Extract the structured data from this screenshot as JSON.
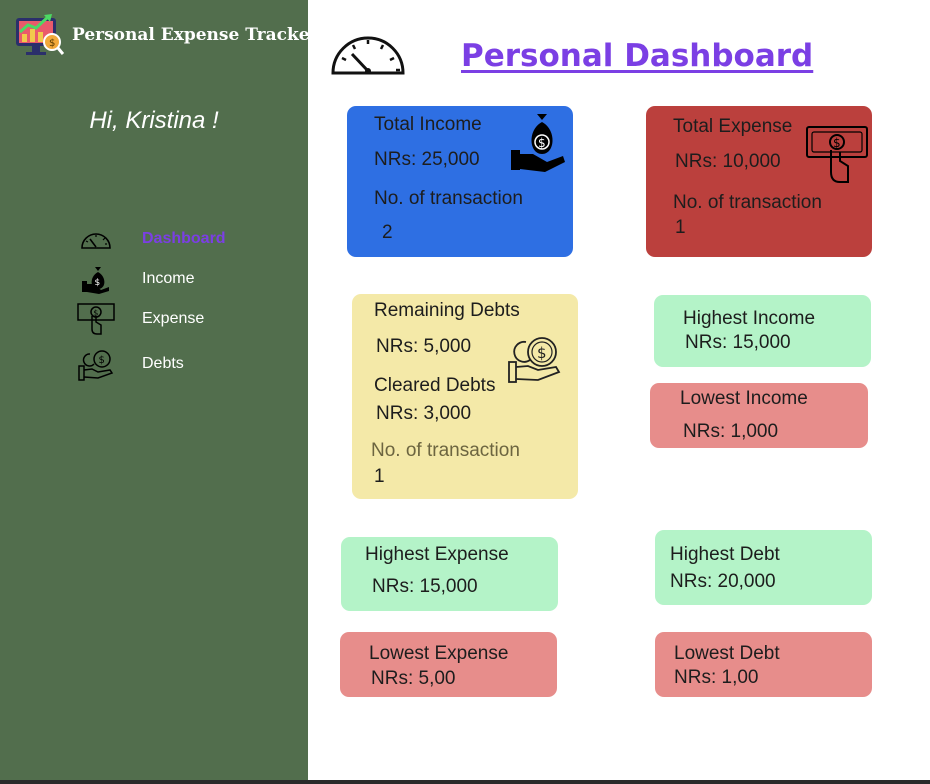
{
  "app": {
    "title": "Personal Expense Tracker"
  },
  "sidebar": {
    "greeting": "Hi, Kristina !",
    "items": [
      {
        "label": "Dashboard",
        "icon": "gauge-icon",
        "active": true
      },
      {
        "label": "Income",
        "icon": "money-bag-hand-icon",
        "active": false
      },
      {
        "label": "Expense",
        "icon": "bill-hand-icon",
        "active": false
      },
      {
        "label": "Debts",
        "icon": "coins-hand-icon",
        "active": false
      }
    ]
  },
  "header": {
    "title": "Personal Dashboard",
    "icon": "gauge-icon"
  },
  "cards": {
    "total_income": {
      "title": "Total Income",
      "amount": "NRs: 25,000",
      "tx_label": "No. of transaction",
      "tx_count": "2",
      "icon": "money-bag-hand-icon"
    },
    "total_expense": {
      "title": "Total Expense",
      "amount": "NRs: 10,000",
      "tx_label": "No. of transaction",
      "tx_count": "1",
      "icon": "bill-hand-icon"
    },
    "debts": {
      "remaining_label": "Remaining Debts",
      "remaining_amount": "NRs: 5,000",
      "cleared_label": "Cleared Debts",
      "cleared_amount": "NRs: 3,000",
      "tx_label": "No. of transaction",
      "tx_count": "1",
      "icon": "coins-hand-icon"
    },
    "highest_income": {
      "title": "Highest Income",
      "amount": "NRs: 15,000"
    },
    "lowest_income": {
      "title": "Lowest Income",
      "amount": "NRs: 1,000"
    },
    "highest_expense": {
      "title": "Highest Expense",
      "amount": "NRs: 15,000"
    },
    "highest_debt": {
      "title": "Highest Debt",
      "amount": "NRs: 20,000"
    },
    "lowest_expense": {
      "title": "Lowest Expense",
      "amount": "NRs: 5,00"
    },
    "lowest_debt": {
      "title": "Lowest Debt",
      "amount": "NRs: 1,00"
    }
  },
  "colors": {
    "sidebar_bg": "#526e4d",
    "accent": "#7b3fe4",
    "income_card": "#2e6fe3",
    "expense_card": "#bb403d",
    "debt_card": "#f4e9a8",
    "highlight_green": "#b4f3c8",
    "highlight_red": "#e78d8b"
  }
}
